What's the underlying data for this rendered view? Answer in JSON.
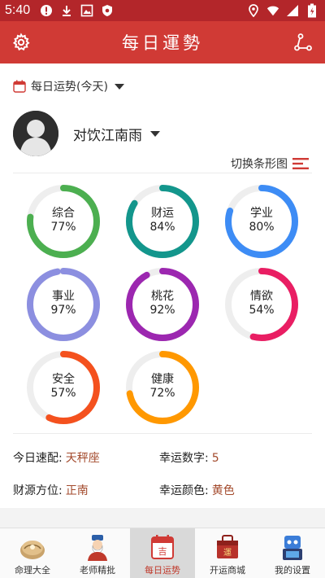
{
  "status_bar": {
    "time": "5:40"
  },
  "app_bar": {
    "title": "每日運勢"
  },
  "date_selector": {
    "label": "每日运势(今天)"
  },
  "user": {
    "name": "对饮江南雨"
  },
  "view_toggle": {
    "label": "切换条形图"
  },
  "fortunes": [
    {
      "label": "综合",
      "value_text": "77%",
      "value": 77,
      "color": "#4caf50"
    },
    {
      "label": "财运",
      "value_text": "84%",
      "value": 84,
      "color": "#13968c"
    },
    {
      "label": "学业",
      "value_text": "80%",
      "value": 80,
      "color": "#3d8cf5"
    },
    {
      "label": "事业",
      "value_text": "97%",
      "value": 97,
      "color": "#8c8fe0"
    },
    {
      "label": "桃花",
      "value_text": "92%",
      "value": 92,
      "color": "#9c27b0"
    },
    {
      "label": "情欲",
      "value_text": "54%",
      "value": 54,
      "color": "#e91e63"
    },
    {
      "label": "安全",
      "value_text": "57%",
      "value": 57,
      "color": "#f4511e"
    },
    {
      "label": "健康",
      "value_text": "72%",
      "value": 72,
      "color": "#ff9800"
    }
  ],
  "info": {
    "match_label": "今日速配:",
    "match_value": "天秤座",
    "number_label": "幸运数字:",
    "number_value": "5",
    "wealth_label": "财源方位:",
    "wealth_value": "正南",
    "color_label": "幸运颜色:",
    "color_value": "黄色"
  },
  "nav": [
    {
      "label": "命理大全",
      "icon": "book-icon",
      "active": false
    },
    {
      "label": "老师精批",
      "icon": "teacher-icon",
      "active": false
    },
    {
      "label": "每日运势",
      "icon": "calendar-icon",
      "active": true
    },
    {
      "label": "开运商城",
      "icon": "shop-icon",
      "active": false
    },
    {
      "label": "我的设置",
      "icon": "robot-icon",
      "active": false
    }
  ],
  "colors": {
    "status_bar": "#b3262a",
    "app_bar": "#d03a35",
    "accent_text": "#a34a2c"
  }
}
